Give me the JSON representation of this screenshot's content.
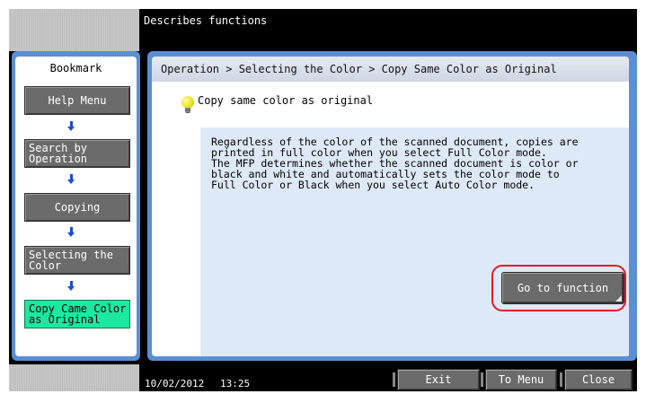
{
  "header": {
    "title": "Describes functions"
  },
  "bookmark": {
    "title": "Bookmark",
    "items": [
      {
        "label": "Help Menu"
      },
      {
        "label": "Search by\nOperation"
      },
      {
        "label": "Copying"
      },
      {
        "label": "Selecting the\nColor"
      },
      {
        "label": "Copy Came Color\nas Original"
      }
    ]
  },
  "main": {
    "breadcrumb": "Operation > Selecting the Color > Copy Same Color as Original",
    "heading": "Copy same color as original",
    "description": "Regardless of the color of the scanned document, copies are\nprinted in full color when you select Full Color mode.\nThe MFP determines whether the scanned document is color or\nblack and white and automatically sets the color mode to\nFull Color or Black when you select Auto Color mode.",
    "goto_label": "Go to function"
  },
  "footer": {
    "date": "10/02/2012",
    "time": "13:25",
    "exit_label": "Exit",
    "menu_label": "To Menu",
    "close_label": "Close"
  },
  "colors": {
    "panel_blue": "#5a8fd6",
    "active_item": "#1ee7a0",
    "highlight_red": "#e21b23",
    "arrow_blue": "#1a4ad8",
    "desc_bg": "#dde9f7"
  }
}
